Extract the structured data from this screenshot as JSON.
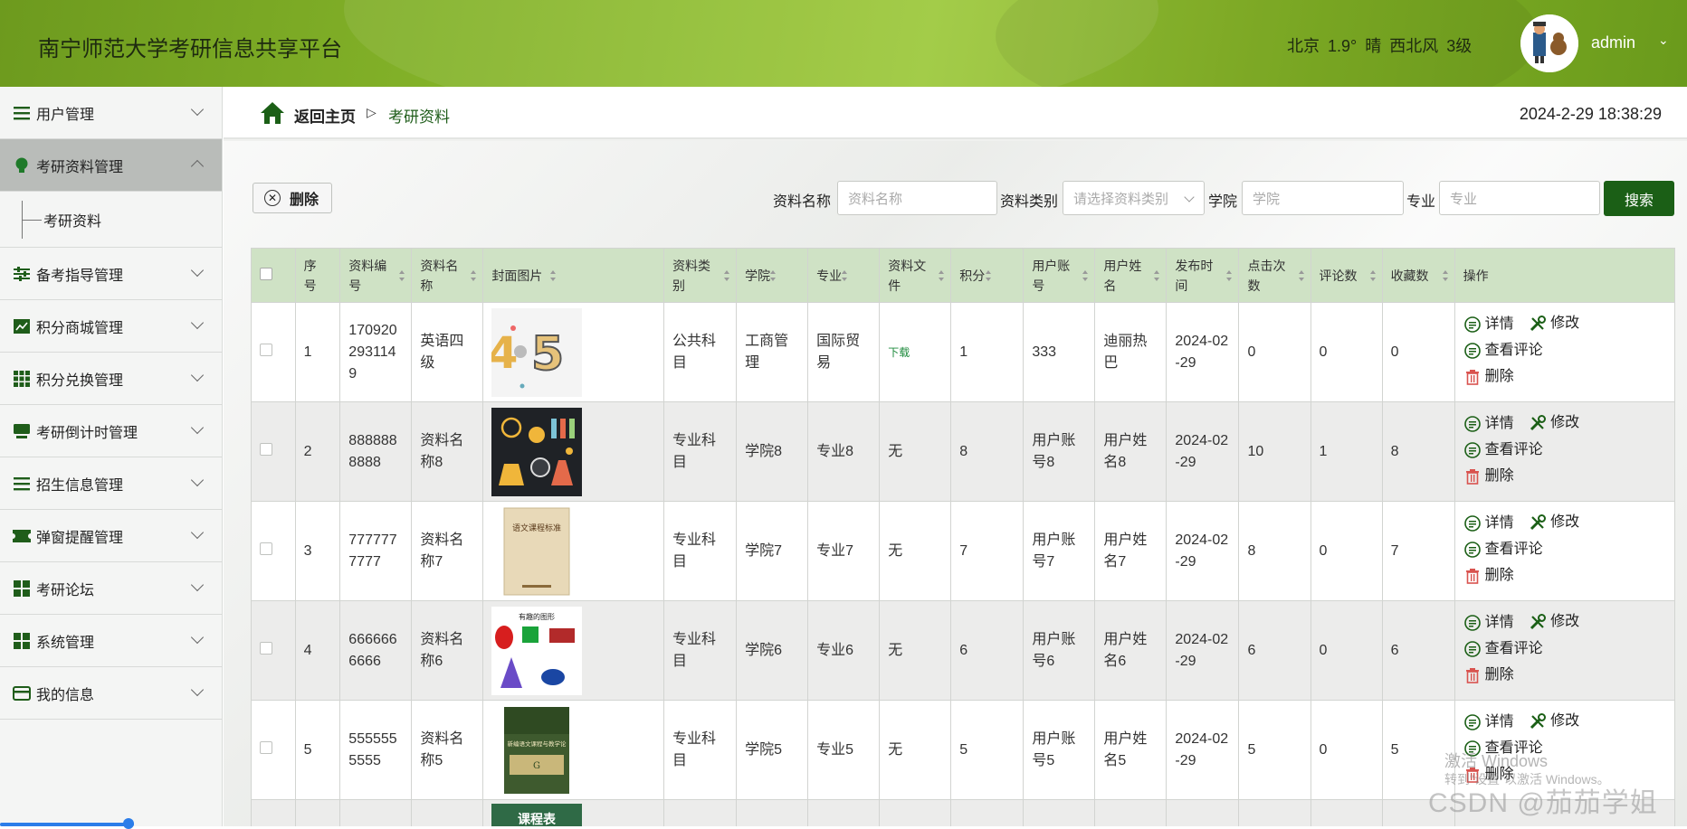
{
  "header": {
    "title": "南宁师范大学考研信息共享平台",
    "weather": "北京 1.9° 晴 西北风 3级",
    "username": "admin"
  },
  "sidebar": {
    "items": [
      {
        "label": "用户管理",
        "icon": "list-icon"
      },
      {
        "label": "考研资料管理",
        "icon": "lightbulb-icon",
        "active": true
      },
      {
        "label": "备考指导管理",
        "icon": "sliders-icon"
      },
      {
        "label": "积分商城管理",
        "icon": "chart-icon"
      },
      {
        "label": "积分兑换管理",
        "icon": "grid-icon"
      },
      {
        "label": "考研倒计时管理",
        "icon": "monitor-icon"
      },
      {
        "label": "招生信息管理",
        "icon": "list-icon"
      },
      {
        "label": "弹窗提醒管理",
        "icon": "ticket-icon"
      },
      {
        "label": "考研论坛",
        "icon": "apps-icon"
      },
      {
        "label": "系统管理",
        "icon": "apps-icon"
      },
      {
        "label": "我的信息",
        "icon": "card-icon"
      }
    ],
    "sub_item": "考研资料"
  },
  "breadcrumb": {
    "home": "返回主页",
    "current": "考研资料"
  },
  "clock": "2024-2-29 18:38:29",
  "toolbar": {
    "delete_label": "删除"
  },
  "filters": {
    "name_label": "资料名称",
    "name_placeholder": "资料名称",
    "type_label": "资料类别",
    "type_placeholder": "请选择资料类别",
    "college_label": "学院",
    "college_placeholder": "学院",
    "major_label": "专业",
    "major_placeholder": "专业",
    "search_label": "搜索"
  },
  "table": {
    "headers": [
      "序号",
      "资料编号",
      "资料名称",
      "封面图片",
      "资料类别",
      "学院",
      "专业",
      "资料文件",
      "积分",
      "用户账号",
      "用户姓名",
      "发布时间",
      "点击次数",
      "评论数",
      "收藏数",
      "操作"
    ],
    "rows": [
      {
        "idx": "1",
        "code": "1709202931149",
        "name": "英语四级",
        "type": "公共科目",
        "college": "工商管理",
        "major": "国际贸易",
        "file": "下载",
        "points": "1",
        "account": "333",
        "uname": "迪丽热巴",
        "date": "2024-02-29",
        "clicks": "0",
        "comments": "0",
        "favs": "0"
      },
      {
        "idx": "2",
        "code": "8888888888",
        "name": "资料名称8",
        "type": "专业科目",
        "college": "学院8",
        "major": "专业8",
        "file": "无",
        "points": "8",
        "account": "用户账号8",
        "uname": "用户姓名8",
        "date": "2024-02-29",
        "clicks": "10",
        "comments": "1",
        "favs": "8"
      },
      {
        "idx": "3",
        "code": "7777777777",
        "name": "资料名称7",
        "type": "专业科目",
        "college": "学院7",
        "major": "专业7",
        "file": "无",
        "points": "7",
        "account": "用户账号7",
        "uname": "用户姓名7",
        "date": "2024-02-29",
        "clicks": "8",
        "comments": "0",
        "favs": "7"
      },
      {
        "idx": "4",
        "code": "6666666666",
        "name": "资料名称6",
        "type": "专业科目",
        "college": "学院6",
        "major": "专业6",
        "file": "无",
        "points": "6",
        "account": "用户账号6",
        "uname": "用户姓名6",
        "date": "2024-02-29",
        "clicks": "6",
        "comments": "0",
        "favs": "6"
      },
      {
        "idx": "5",
        "code": "5555555555",
        "name": "资料名称5",
        "type": "专业科目",
        "college": "学院5",
        "major": "专业5",
        "file": "无",
        "points": "5",
        "account": "用户账号5",
        "uname": "用户姓名5",
        "date": "2024-02-29",
        "clicks": "5",
        "comments": "0",
        "favs": "5"
      }
    ],
    "ops": {
      "detail": "详情",
      "edit": "修改",
      "comments": "查看评论",
      "delete": "删除"
    }
  },
  "covers": {
    "r3_title": "语文课程标准",
    "r4_title": "有趣的图形",
    "r5_title": "新编语文课程与教学论",
    "r6_title": "课程表"
  },
  "watermark": {
    "activate": "激活 Windows",
    "activate_hint": "转到\"设置\"以激活 Windows。",
    "csdn": "CSDN @茄茄学姐"
  },
  "colors": {
    "header": "#86b52a",
    "accent": "#1b5f16",
    "table_head": "#cfe2c5"
  }
}
